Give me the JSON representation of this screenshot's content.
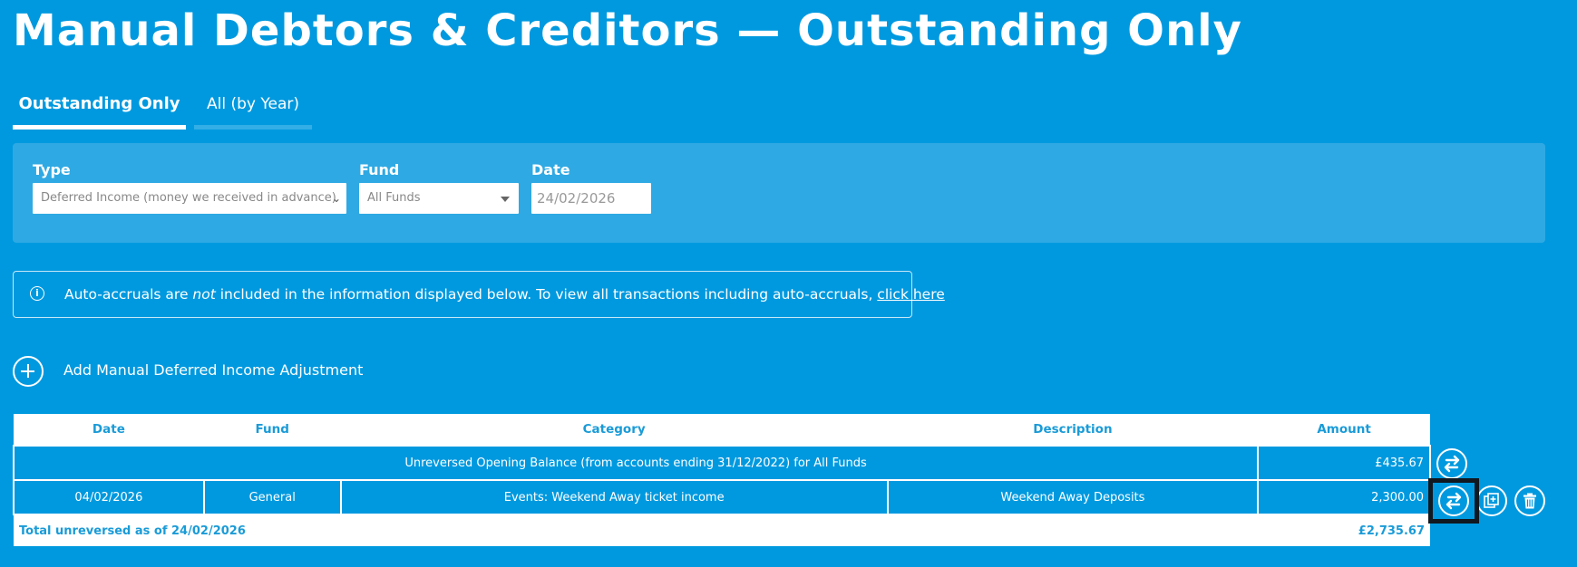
{
  "page": {
    "title": "Manual Debtors & Creditors — Outstanding Only"
  },
  "tabs": [
    {
      "label": "Outstanding Only",
      "active": true
    },
    {
      "label": "All (by Year)",
      "active": false
    }
  ],
  "filters": {
    "type": {
      "label": "Type",
      "value": "Deferred Income (money we received in advance)"
    },
    "fund": {
      "label": "Fund",
      "value": "All Funds"
    },
    "date": {
      "label": "Date",
      "value": "24/02/2026"
    }
  },
  "info": {
    "prefix": "Auto-accruals are ",
    "emphasis": "not",
    "suffix": " included in the information displayed below. To view all transactions including auto-accruals, ",
    "link": "click here"
  },
  "add_action": {
    "label": "Add Manual Deferred Income Adjustment"
  },
  "table": {
    "columns": [
      "Date",
      "Fund",
      "Category",
      "Description",
      "Amount"
    ],
    "opening_balance": {
      "text": "Unreversed Opening Balance (from accounts ending 31/12/2022) for All Funds",
      "amount": "£435.67"
    },
    "rows": [
      {
        "date": "04/02/2026",
        "fund": "General",
        "category": "Events: Weekend Away ticket income",
        "description": "Weekend Away Deposits",
        "amount": "2,300.00"
      }
    ],
    "total": {
      "label": "Total unreversed as of 24/02/2026",
      "amount": "£2,735.67"
    }
  },
  "icons": {
    "reverse": "reverse-arrows-icon",
    "copy": "copy-icon",
    "delete": "trash-icon",
    "info": "info-icon",
    "add": "plus-circle-icon"
  },
  "colors": {
    "background": "#0099df",
    "panel": "#2fa9e3",
    "header_text": "#1a9bd7",
    "highlight": "#101820"
  }
}
